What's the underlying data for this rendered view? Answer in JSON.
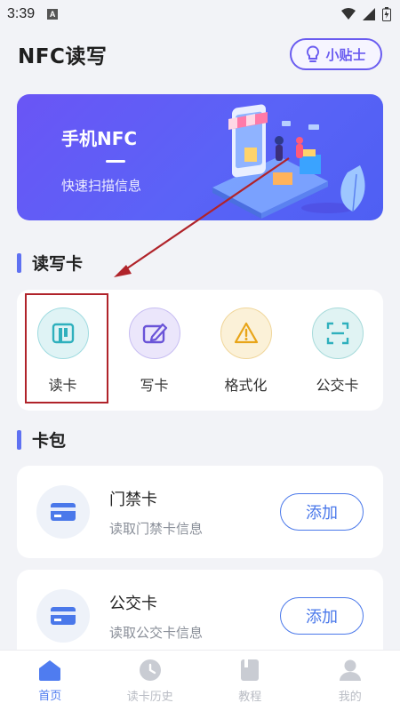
{
  "status_bar": {
    "time": "3:39",
    "badge": "A"
  },
  "header": {
    "title": "NFC读写",
    "tips_label": "小贴士"
  },
  "banner": {
    "title": "手机NFC",
    "subtitle": "快速扫描信息"
  },
  "sections": {
    "read_write": "读写卡",
    "wallet": "卡包"
  },
  "tools": [
    {
      "label": "读卡",
      "icon": "read-card-icon",
      "color": "#dff3f5"
    },
    {
      "label": "写卡",
      "icon": "write-card-icon",
      "color": "#ebe6fb"
    },
    {
      "label": "格式化",
      "icon": "warning-icon",
      "color": "#fbf1d8"
    },
    {
      "label": "公交卡",
      "icon": "scan-icon",
      "color": "#e0f3f3"
    }
  ],
  "wallet": [
    {
      "name": "门禁卡",
      "desc": "读取门禁卡信息",
      "button": "添加"
    },
    {
      "name": "公交卡",
      "desc": "读取公交卡信息",
      "button": "添加"
    }
  ],
  "nav": [
    {
      "label": "首页",
      "icon": "home-icon",
      "active": true
    },
    {
      "label": "读卡历史",
      "icon": "history-icon",
      "active": false
    },
    {
      "label": "教程",
      "icon": "book-icon",
      "active": false
    },
    {
      "label": "我的",
      "icon": "profile-icon",
      "active": false
    }
  ],
  "colors": {
    "accent": "#5f71f2",
    "primary_button": "#4a78ea",
    "annotation": "#b0232a"
  }
}
